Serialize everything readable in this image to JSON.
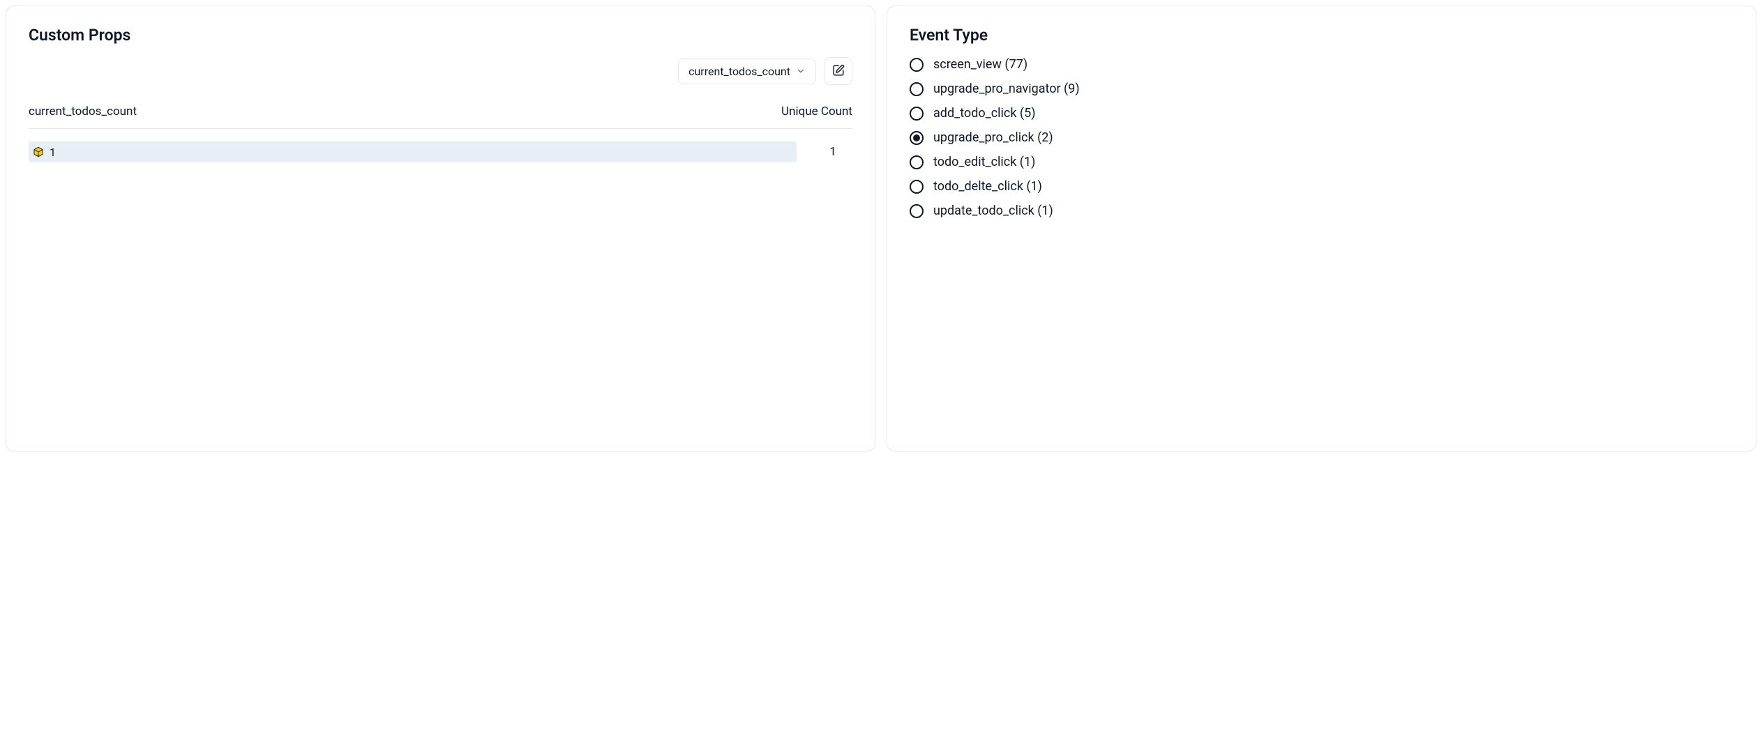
{
  "customProps": {
    "title": "Custom Props",
    "dropdown": {
      "selected": "current_todos_count"
    },
    "table": {
      "header_prop": "current_todos_count",
      "header_count": "Unique Count",
      "rows": [
        {
          "label": "1",
          "count": "1"
        }
      ]
    }
  },
  "eventType": {
    "title": "Event Type",
    "selected": "upgrade_pro_click",
    "items": [
      {
        "id": "screen_view",
        "label": "screen_view (77)"
      },
      {
        "id": "upgrade_pro_navigator",
        "label": "upgrade_pro_navigator (9)"
      },
      {
        "id": "add_todo_click",
        "label": "add_todo_click (5)"
      },
      {
        "id": "upgrade_pro_click",
        "label": "upgrade_pro_click (2)"
      },
      {
        "id": "todo_edit_click",
        "label": "todo_edit_click (1)"
      },
      {
        "id": "todo_delte_click",
        "label": "todo_delte_click (1)"
      },
      {
        "id": "update_todo_click",
        "label": "update_todo_click (1)"
      }
    ]
  }
}
